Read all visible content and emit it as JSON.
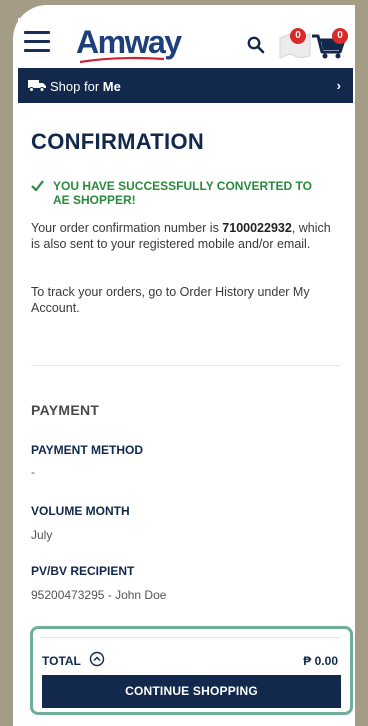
{
  "header": {
    "logo_text": "Amway",
    "wishlist_count": "0",
    "cart_count": "0"
  },
  "shop_bar": {
    "prefix": "Shop for ",
    "target": "Me"
  },
  "confirmation": {
    "title": "CONFIRMATION",
    "success_message": "YOU HAVE SUCCESSFULLY CONVERTED TO AE SHOPPER!",
    "order_text_before": "Your order confirmation number is ",
    "order_number": "7100022932",
    "order_text_after": ", which is also sent to your registered mobile and/or email.",
    "track_text": "To track your orders, go to Order History under My Account."
  },
  "payment": {
    "section_title": "PAYMENT",
    "method_label": "PAYMENT METHOD",
    "method_value": "-",
    "volume_label": "VOLUME MONTH",
    "volume_value": "July",
    "recipient_label": "PV/BV RECIPIENT",
    "recipient_value": "95200473295 - John Doe"
  },
  "footer": {
    "total_label": "TOTAL",
    "total_value": "₱ 0.00",
    "continue_label": "CONTINUE SHOPPING"
  },
  "colors": {
    "navy": "#12284c",
    "success_green": "#2a8a3d",
    "badge_red": "#d92a2a",
    "highlight_teal": "#6fae9b",
    "frame": "#a59c86"
  }
}
